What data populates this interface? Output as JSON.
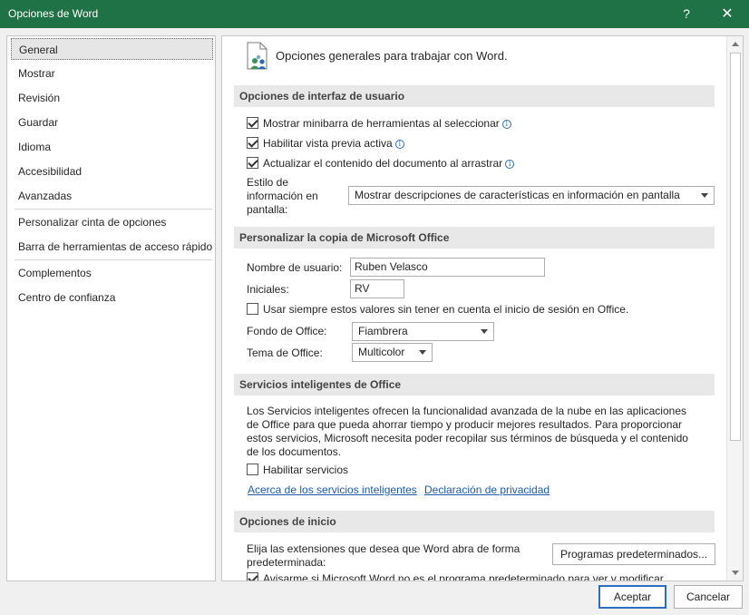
{
  "window": {
    "title": "Opciones de Word",
    "help_glyph": "?",
    "close_glyph": "✕",
    "accent_color": "#1f7245"
  },
  "nav": {
    "items": [
      {
        "label": "General",
        "selected": true
      },
      {
        "label": "Mostrar"
      },
      {
        "label": "Revisión"
      },
      {
        "label": "Guardar"
      },
      {
        "label": "Idioma"
      },
      {
        "label": "Accesibilidad"
      },
      {
        "label": "Avanzadas"
      },
      {
        "label": "Personalizar cinta de opciones"
      },
      {
        "label": "Barra de herramientas de acceso rápido"
      },
      {
        "label": "Complementos"
      },
      {
        "label": "Centro de confianza"
      }
    ]
  },
  "content": {
    "header": "Opciones generales para trabajar con Word.",
    "ui_section": {
      "title": "Opciones de interfaz de usuario",
      "options": [
        {
          "label": "Mostrar minibarra de herramientas al seleccionar",
          "checked": true
        },
        {
          "label": "Habilitar vista previa activa",
          "checked": true
        },
        {
          "label": "Actualizar el contenido del documento al arrastrar",
          "checked": true
        }
      ],
      "info_glyph": "i",
      "style_label_1": "Estilo de",
      "style_label_2": "información en",
      "style_label_3": "pantalla:",
      "style_value": "Mostrar descripciones de características en información en pantalla"
    },
    "personalize_section": {
      "title": "Personalizar la copia de Microsoft Office",
      "username_label": "Nombre de usuario:",
      "username_value": "Ruben Velasco",
      "initials_label": "Iniciales:",
      "initials_value": "RV",
      "always_label": "Usar siempre estos valores sin tener en cuenta el inicio de sesión en Office.",
      "always_checked": false,
      "background_label": "Fondo de Office:",
      "background_value": "Fiambrera",
      "theme_label": "Tema de Office:",
      "theme_value": "Multicolor"
    },
    "services_section": {
      "title": "Servicios inteligentes de Office",
      "description": "Los Servicios inteligentes ofrecen la funcionalidad avanzada de la nube en las aplicaciones de Office para que pueda ahorrar tiempo y producir mejores resultados. Para proporcionar estos servicios, Microsoft necesita poder recopilar sus términos de búsqueda y el contenido de los documentos.",
      "enable_label": "Habilitar servicios",
      "enable_checked": false,
      "link_about": "Acerca de los servicios inteligentes",
      "link_privacy": "Declaración de privacidad"
    },
    "startup_section": {
      "title": "Opciones de inicio",
      "extensions_text_1": "Elija las extensiones que desea que Word abra de forma",
      "extensions_text_2": "predeterminada:",
      "default_programs_button": "Programas predeterminados...",
      "notify_label": "Avisarme si Microsoft Word no es el programa predeterminado para ver y modificar",
      "notify_checked": true
    }
  },
  "footer": {
    "accept": "Aceptar",
    "cancel": "Cancelar"
  }
}
